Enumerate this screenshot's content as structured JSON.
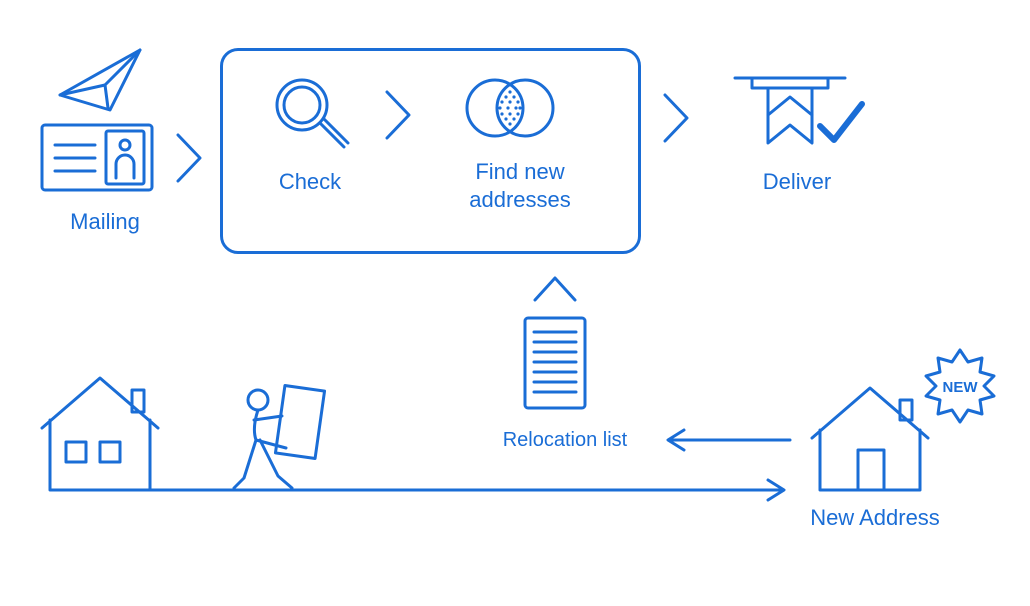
{
  "color": "#1a6dd6",
  "labels": {
    "mailing": "Mailing",
    "check": "Check",
    "findNew": "Find new\naddresses",
    "deliver": "Deliver",
    "relocation": "Relocation list",
    "newAddress": "New Address",
    "newBadge": "NEW"
  }
}
